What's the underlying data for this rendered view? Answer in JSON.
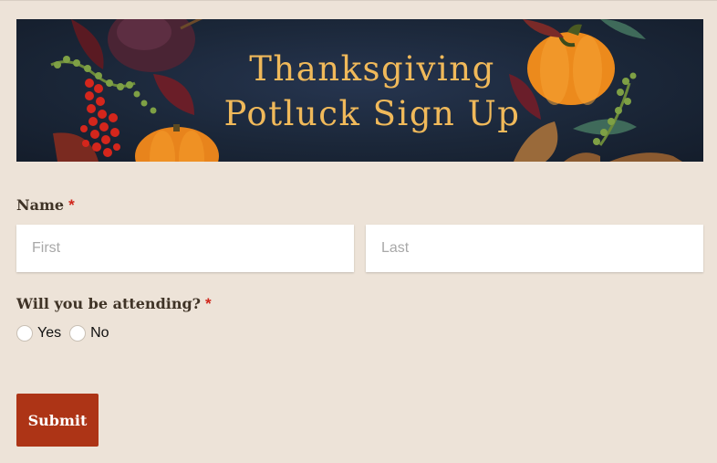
{
  "banner": {
    "title_line1": "Thanksgiving",
    "title_line2": "Potluck Sign Up",
    "background_color": "#1b2739",
    "title_color": "#f0b95a"
  },
  "form": {
    "name_field": {
      "label": "Name",
      "required_mark": "*",
      "first_placeholder": "First",
      "last_placeholder": "Last"
    },
    "attending_field": {
      "label": "Will you be attending?",
      "required_mark": "*",
      "options": [
        "Yes",
        "No"
      ]
    },
    "submit_label": "Submit"
  },
  "colors": {
    "page_background": "#ede3d8",
    "required": "#d0261b",
    "submit_background": "#ad3416",
    "label_text": "#3f3326"
  }
}
